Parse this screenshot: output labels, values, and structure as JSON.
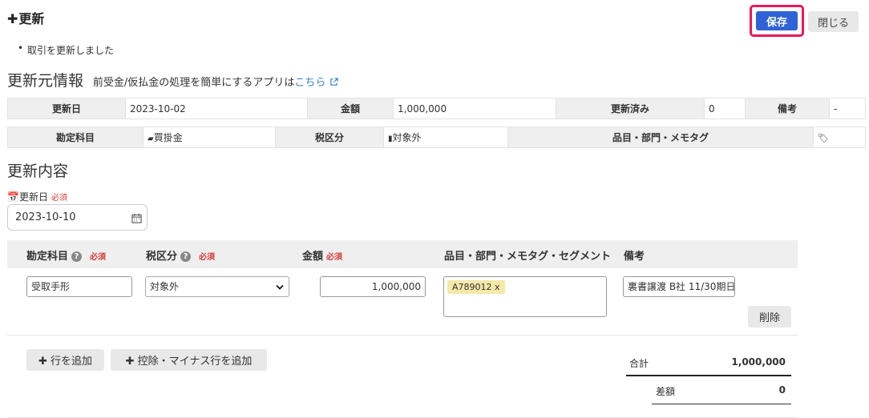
{
  "header": {
    "title": "更新",
    "save_label": "保存",
    "close_label": "閉じる"
  },
  "message": "取引を更新しました",
  "source_section": {
    "title": "更新元情報",
    "subtitle": "前受金/仮払金の処理を簡単にするアプリは",
    "link_text": "こちら",
    "row1": {
      "update_date_label": "更新日",
      "update_date": "2023-10-02",
      "amount_label": "金額",
      "amount": "1,000,000",
      "updated_label": "更新済み",
      "updated": "0",
      "remarks_label": "備考",
      "remarks": "-"
    },
    "row2": {
      "account_label": "勘定科目",
      "account": "買掛金",
      "tax_label": "税区分",
      "tax": "対象外",
      "items_label": "品目・部門・メモタグ"
    }
  },
  "content_section": {
    "title": "更新内容",
    "date_label": "更新日",
    "required": "必須",
    "date_value": "2023-10-10",
    "columns": {
      "account": "勘定科目",
      "tax": "税区分",
      "amount": "金額",
      "items": "品目・部門・メモタグ・セグメント",
      "remarks": "備考"
    },
    "row": {
      "account": "受取手形",
      "tax": "対象外",
      "amount": "1,000,000",
      "tag": "A789012 x",
      "remarks": "裏書譲渡 B社 11/30期日"
    },
    "delete_label": "削除",
    "add_row_label": "行を追加",
    "add_minus_row_label": "控除・マイナス行を追加",
    "total_label": "合計",
    "total_value": "1,000,000",
    "diff_label": "差額",
    "diff_value": "0"
  },
  "colors": {
    "accent": "#2f62d5",
    "highlight": "#e8195a",
    "required": "#d43f3a",
    "link": "#3b82c4"
  }
}
